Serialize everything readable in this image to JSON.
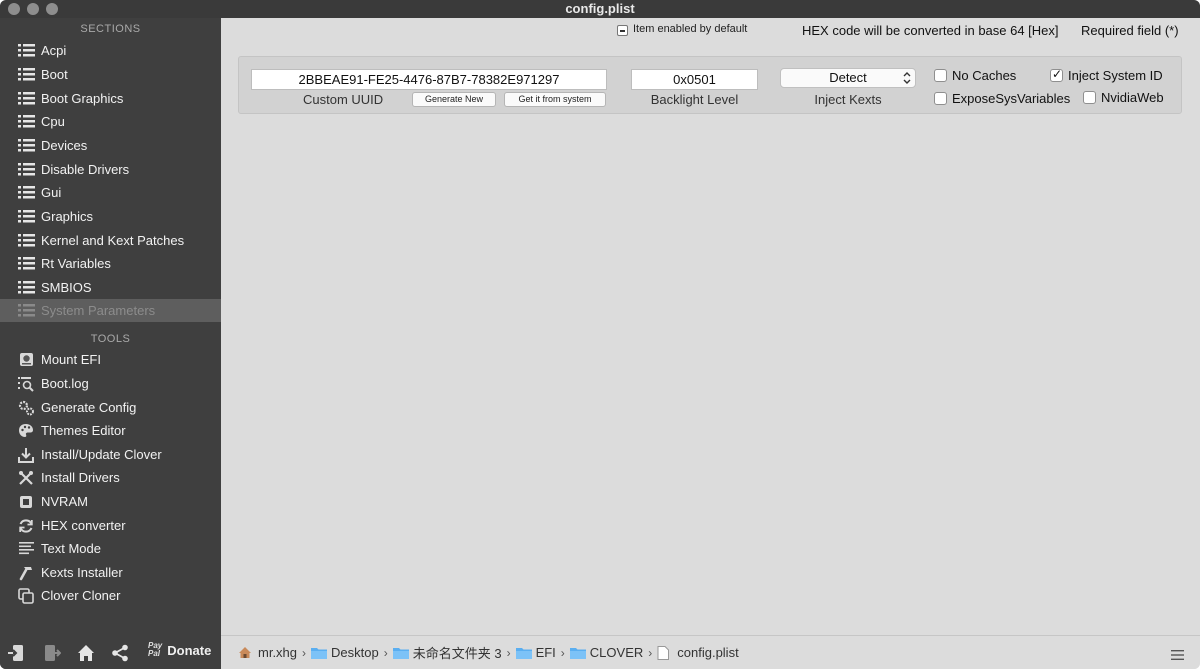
{
  "window": {
    "title": "config.plist"
  },
  "sidebar": {
    "sections_header": "SECTIONS",
    "sections": [
      {
        "label": "Acpi"
      },
      {
        "label": "Boot"
      },
      {
        "label": "Boot Graphics"
      },
      {
        "label": "Cpu"
      },
      {
        "label": "Devices"
      },
      {
        "label": "Disable Drivers"
      },
      {
        "label": "Gui"
      },
      {
        "label": "Graphics"
      },
      {
        "label": "Kernel and Kext Patches"
      },
      {
        "label": "Rt Variables"
      },
      {
        "label": "SMBIOS"
      },
      {
        "label": "System Parameters",
        "selected": true
      }
    ],
    "tools_header": "TOOLS",
    "tools": [
      {
        "label": "Mount EFI",
        "icon": "disk-icon"
      },
      {
        "label": "Boot.log",
        "icon": "log-search-icon"
      },
      {
        "label": "Generate Config",
        "icon": "gears-icon"
      },
      {
        "label": "Themes Editor",
        "icon": "palette-icon"
      },
      {
        "label": "Install/Update Clover",
        "icon": "download-icon"
      },
      {
        "label": "Install Drivers",
        "icon": "tools-icon"
      },
      {
        "label": "NVRAM",
        "icon": "chip-icon"
      },
      {
        "label": "HEX converter",
        "icon": "refresh-icon"
      },
      {
        "label": "Text Mode",
        "icon": "text-lines-icon"
      },
      {
        "label": "Kexts Installer",
        "icon": "hammer-icon"
      },
      {
        "label": "Clover Cloner",
        "icon": "copy-icon"
      }
    ],
    "bottom": {
      "donate_label": "Donate",
      "paypal_label_1": "Pay",
      "paypal_label_2": "Pal"
    }
  },
  "main": {
    "item_enabled_note": "Item enabled by default",
    "hex_note": "HEX code will be converted in base 64 [Hex]",
    "required_note": "Required field (*)",
    "custom_uuid": {
      "value": "2BBEAE91-FE25-4476-87B7-78382E971297",
      "label": "Custom UUID",
      "generate_button": "Generate New",
      "get_button": "Get it from system"
    },
    "backlight": {
      "value": "0x0501",
      "label": "Backlight Level"
    },
    "inject_kexts": {
      "selected": "Detect",
      "label": "Inject Kexts"
    },
    "checkboxes": {
      "no_caches": {
        "label": "No Caches",
        "checked": false
      },
      "inject_system_id": {
        "label": "Inject System ID",
        "checked": true
      },
      "expose_sys_variables": {
        "label": "ExposeSysVariables",
        "checked": false
      },
      "nvidia_web": {
        "label": "NvidiaWeb",
        "checked": false
      }
    }
  },
  "pathbar": {
    "items": [
      {
        "label": "mr.xhg",
        "icon": "home-icon"
      },
      {
        "label": "Desktop",
        "icon": "folder-icon"
      },
      {
        "label": "未命名文件夹 3",
        "icon": "folder-icon"
      },
      {
        "label": "EFI",
        "icon": "folder-icon"
      },
      {
        "label": "CLOVER",
        "icon": "folder-icon"
      },
      {
        "label": "config.plist",
        "icon": "file-icon"
      }
    ],
    "separator": "›"
  }
}
